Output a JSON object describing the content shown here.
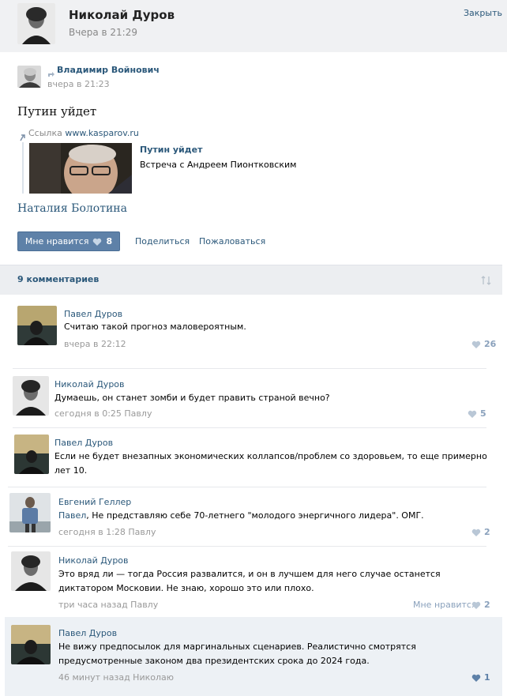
{
  "header": {
    "name": "Николай Дуров",
    "time": "Вчера в 21:29",
    "close_label": "Закрыть"
  },
  "post": {
    "author": "Владимир Войнович",
    "time": "вчера в 21:23",
    "title": "Путин уйдет",
    "link_prefix": "Ссылка",
    "link_url": "www.kasparov.ru",
    "card_title": "Путин уйдет",
    "card_desc": "Встреча с Андреем Пионтковским",
    "signature": "Наталия Болотина",
    "like_label": "Мне нравится",
    "like_count": "8",
    "share_label": "Поделиться",
    "report_label": "Пожаловаться"
  },
  "comments_header": {
    "label": "9 комментариев"
  },
  "comments": [
    {
      "author": "Павел Дуров",
      "line1": "Считаю такой прогноз маловероятным.",
      "line2": "",
      "meta": "вчера в 22:12",
      "like_label": "",
      "likes": "26"
    },
    {
      "author": "Николай Дуров",
      "line1": "Думаешь, он станет зомби и будет править страной вечно?",
      "line2": "",
      "meta": "сегодня в 0:25 Павлу",
      "like_label": "",
      "likes": "5"
    },
    {
      "author": "Павел Дуров",
      "line1": "Если не будет внезапных экономических коллапсов/проблем со здоровьем, то еще примерно",
      "line2": "лет 10.",
      "meta": "",
      "like_label": "",
      "likes": ""
    },
    {
      "author": "Евгений Геллер",
      "reply_to": "Павел",
      "line1": ", Не представляю себе 70-летнего \"молодого энергичного лидера\". ОМГ.",
      "line2": "",
      "meta": "сегодня в 1:28 Павлу",
      "like_label": "",
      "likes": "2"
    },
    {
      "author": "Николай Дуров",
      "line1": "Это вряд ли — тогда Россия развалится, и он в лучшем для него случае останется",
      "line2": "диктатором Московии. Не знаю, хорошо это или плохо.",
      "meta": "три часа назад Павлу",
      "like_label": "Мне нравится",
      "likes": "2"
    },
    {
      "author": "Павел Дуров",
      "line1": "Не вижу предпосылок для маргинальных сценариев. Реалистично смотрятся",
      "line2": "предусмотренные законом два президентских срока до 2024 года.",
      "meta": "46 минут назад Николаю",
      "like_label": "",
      "likes": "1"
    }
  ],
  "colors": {
    "link": "#2b587a",
    "button_bg": "#5e81a8",
    "header_bg": "#f0f1f3",
    "highlight_bg": "#edf1f5"
  },
  "icons": [
    "heart-icon",
    "repost-arrow-icon",
    "link-icon",
    "sort-arrows-icon"
  ]
}
